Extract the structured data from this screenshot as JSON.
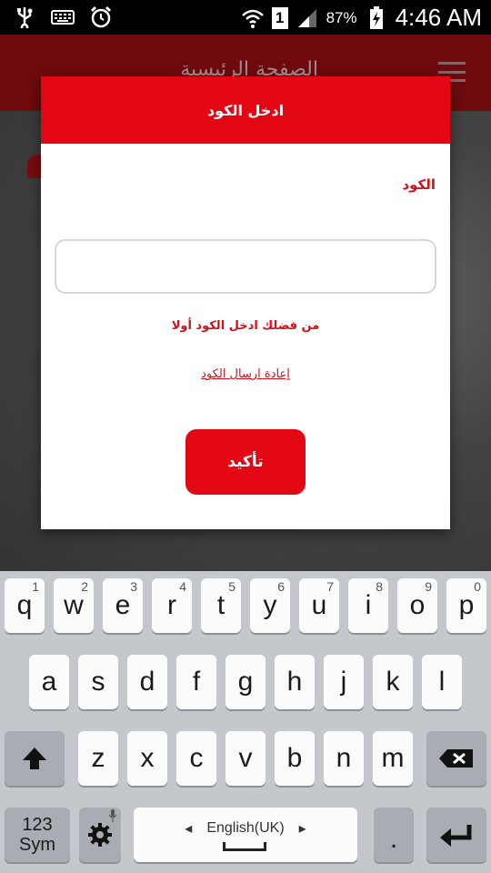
{
  "status_bar": {
    "sim_slot": "1",
    "battery_percent": "87%",
    "time": "4:46 AM",
    "icons": [
      "usb-icon",
      "keyboard-icon",
      "alarm-clock-icon",
      "wifi-icon",
      "signal-icon",
      "battery-charging-icon"
    ]
  },
  "app": {
    "header_title": "الصفحة الرئيسية",
    "menu_icon": "hamburger-menu-icon",
    "notification_icon": "bell-icon"
  },
  "dialog": {
    "title": "ادخل الكود",
    "field_label": "الكود",
    "input_value": "",
    "input_placeholder": "",
    "error_message": "من فضلك ادخل الكود أولا",
    "resend_link": "إعادة ارسال الكود",
    "confirm_button": "تأكيد"
  },
  "keyboard": {
    "row1": [
      {
        "key": "q",
        "hint": "1"
      },
      {
        "key": "w",
        "hint": "2"
      },
      {
        "key": "e",
        "hint": "3"
      },
      {
        "key": "r",
        "hint": "4"
      },
      {
        "key": "t",
        "hint": "5"
      },
      {
        "key": "y",
        "hint": "6"
      },
      {
        "key": "u",
        "hint": "7"
      },
      {
        "key": "i",
        "hint": "8"
      },
      {
        "key": "o",
        "hint": "9"
      },
      {
        "key": "p",
        "hint": "0"
      }
    ],
    "row2": [
      "a",
      "s",
      "d",
      "f",
      "g",
      "h",
      "j",
      "k",
      "l"
    ],
    "row3": [
      "z",
      "x",
      "c",
      "v",
      "b",
      "n",
      "m"
    ],
    "sym_key_line1": "123",
    "sym_key_line2": "Sym",
    "language_label": "English(UK)",
    "period_key": ".",
    "colors": {
      "accent": "#e30613",
      "header": "#6f0a0e"
    }
  }
}
